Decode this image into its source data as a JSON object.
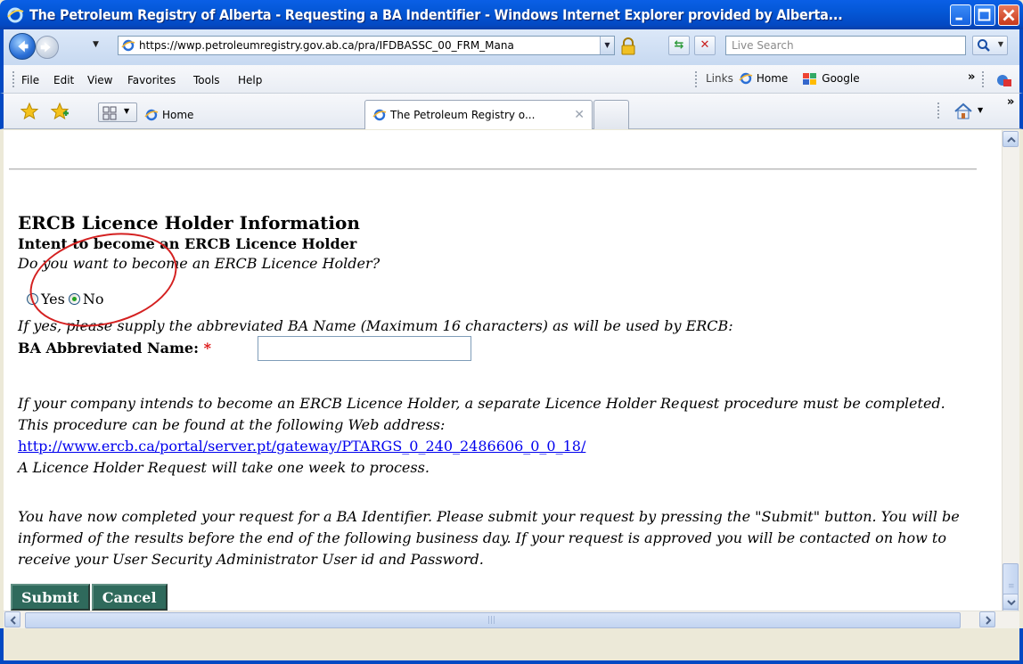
{
  "window": {
    "title": "The Petroleum Registry of Alberta - Requesting a BA Indentifier - Windows Internet Explorer provided by Alberta..."
  },
  "addressbar": {
    "url": "https://wwp.petroleumregistry.gov.ab.ca/pra/IFDBASSC_00_FRM_Mana",
    "search_placeholder": "Live Search"
  },
  "menu": {
    "items": [
      "File",
      "Edit",
      "View",
      "Favorites",
      "Tools",
      "Help"
    ],
    "links_label": "Links",
    "links": [
      "Home",
      "Google"
    ]
  },
  "tabs": {
    "home_label": "Home",
    "active_label": "The Petroleum Registry o..."
  },
  "page": {
    "section_title": "ERCB Licence Holder Information",
    "intent_title": "Intent to become an ERCB Licence Holder",
    "intent_question": "Do you want to become an ERCB Licence Holder?",
    "radio_yes": "Yes",
    "radio_no": "No",
    "selected": "No",
    "abbr_hint": "If yes, please supply the abbreviated BA Name (Maximum 16 characters) as will be used by ERCB:",
    "abbr_label": "BA Abbreviated Name:",
    "required_mark": "*",
    "abbr_value": "",
    "info_text": "If your company intends to become an ERCB Licence Holder, a separate Licence Holder Request procedure must be completed.  This procedure can be found at the following Web address:",
    "info_link": "http://www.ercb.ca/portal/server.pt/gateway/PTARGS_0_240_2486606_0_0_18/",
    "info_after": "A Licence Holder Request will take one week to process.",
    "final_text": "You have now completed your request for a BA Identifier. Please submit your request by pressing the \"Submit\" button. You will be informed of the results before the end of the following business day. If your request is approved you will be contacted on how to receive your User Security Administrator User id and Password.",
    "submit_label": "Submit",
    "cancel_label": "Cancel"
  },
  "colors": {
    "titlebar": "#0457d6",
    "button_bg": "#2f6a5c",
    "link": "#0000ee",
    "annotation": "#d42020"
  }
}
